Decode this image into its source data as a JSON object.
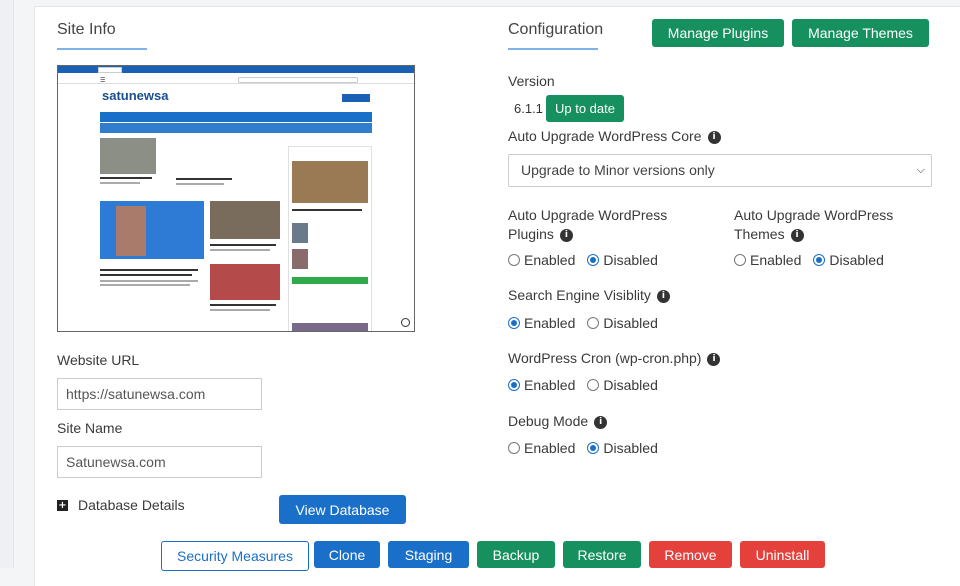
{
  "site_info": {
    "title": "Site Info",
    "website_url_label": "Website URL",
    "website_url_value": "https://satunewsa.com",
    "site_name_label": "Site Name",
    "site_name_value": "Satunewsa.com",
    "database_details_label": "Database Details",
    "view_database_label": "View Database",
    "preview_logo_text": "satunewsa"
  },
  "configuration": {
    "title": "Configuration",
    "manage_plugins_label": "Manage Plugins",
    "manage_themes_label": "Manage Themes",
    "version_label": "Version",
    "version_value": "6.1.1",
    "version_status": "Up to date",
    "auto_upgrade_core_label": "Auto Upgrade WordPress Core",
    "auto_upgrade_core_selected": "Upgrade to Minor versions only",
    "auto_upgrade_plugins_label_1": "Auto Upgrade WordPress",
    "auto_upgrade_plugins_label_2": "Plugins",
    "auto_upgrade_themes_label_1": "Auto Upgrade WordPress",
    "auto_upgrade_themes_label_2": "Themes",
    "search_engine_label": "Search Engine Visiblity",
    "wp_cron_label": "WordPress Cron (wp-cron.php)",
    "debug_mode_label": "Debug Mode",
    "enabled_label": "Enabled",
    "disabled_label": "Disabled",
    "selections": {
      "plugins": "Disabled",
      "themes": "Disabled",
      "search_engine": "Enabled",
      "wp_cron": "Enabled",
      "debug_mode": "Disabled"
    }
  },
  "actions": {
    "security_measures": "Security Measures",
    "clone": "Clone",
    "staging": "Staging",
    "backup": "Backup",
    "restore": "Restore",
    "remove": "Remove",
    "uninstall": "Uninstall"
  },
  "icons": {
    "info": "info-icon",
    "plus": "plus-square-icon",
    "chevron": "chevron-down-icon"
  },
  "colors": {
    "green": "#17905f",
    "blue": "#1a6fc9",
    "red": "#e4413c"
  }
}
